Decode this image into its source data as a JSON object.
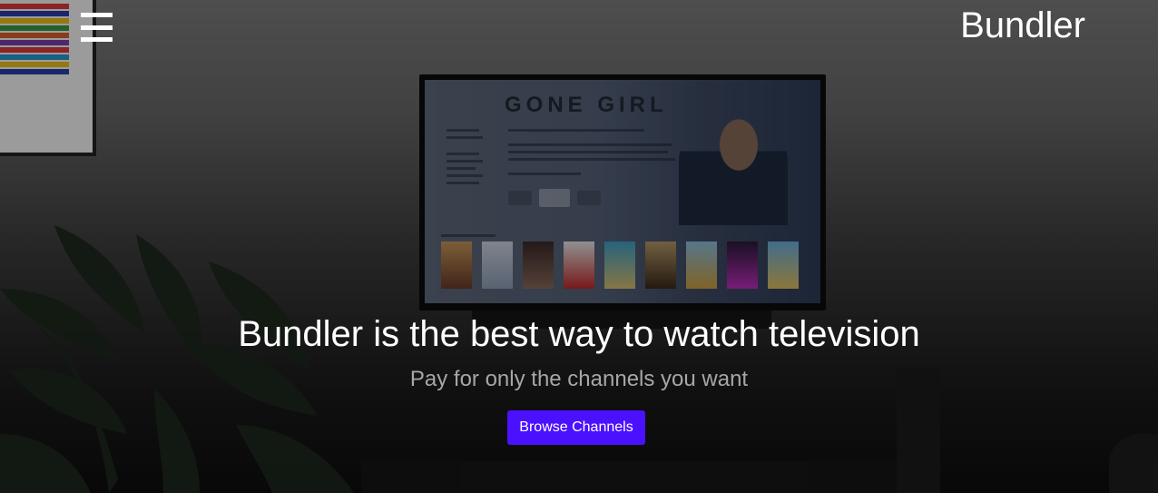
{
  "header": {
    "brand": "Bundler",
    "menu_icon": "hamburger-menu-icon"
  },
  "hero": {
    "headline": "Bundler is the best way to watch television",
    "subheadline": "Pay for only the channels you want",
    "cta_label": "Browse Channels"
  },
  "background": {
    "tv_screen_title": "GONE GIRL"
  },
  "colors": {
    "cta": "#4b11ff",
    "headline": "#ffffff",
    "subheadline": "#a7a7a7"
  }
}
